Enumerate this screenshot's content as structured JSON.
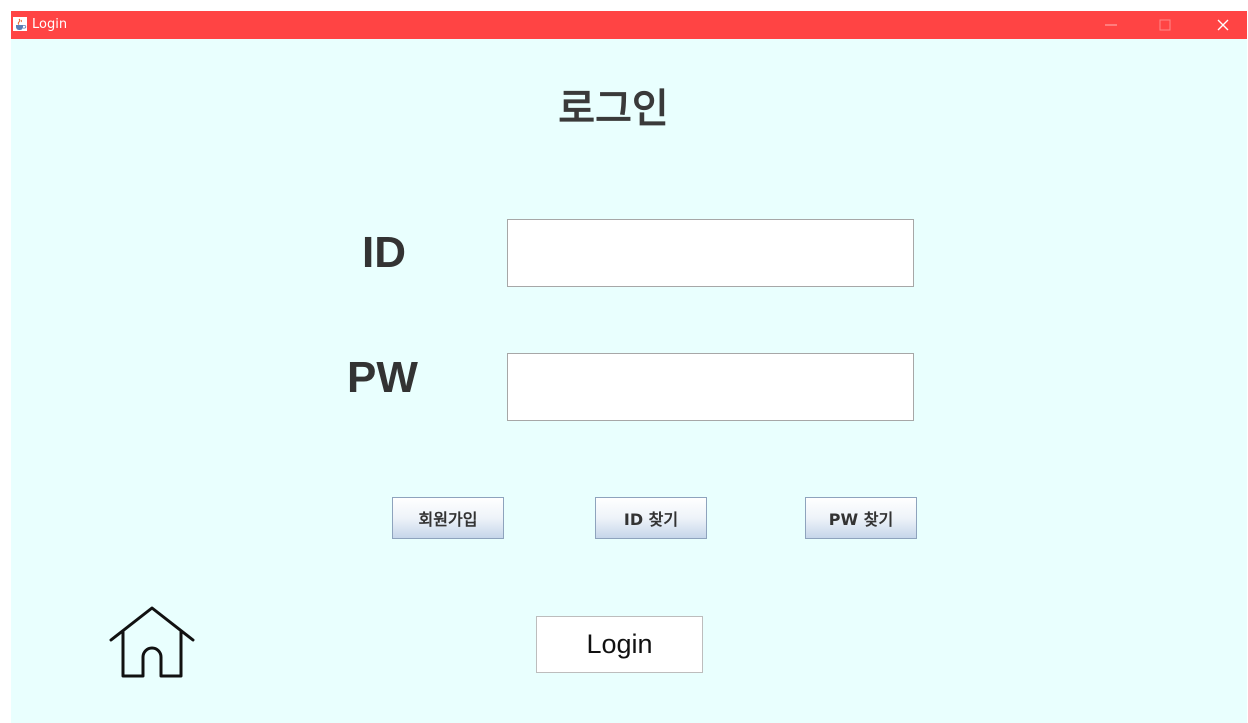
{
  "window": {
    "title": "Login",
    "title_icon": "java-cup-icon",
    "controls": {
      "minimize": "—",
      "maximize": "□",
      "close": "✕"
    },
    "titlebar_color": "#ff4444",
    "background_color": "#e9fffe"
  },
  "form": {
    "heading": "로그인",
    "id_label": "ID",
    "id_value": "",
    "pw_label": "PW",
    "pw_value": ""
  },
  "actions": {
    "signup_label": "회원가입",
    "find_id_label": "ID 찾기",
    "find_pw_label": "PW 찾기",
    "login_label": "Login",
    "home_icon": "home-icon"
  }
}
